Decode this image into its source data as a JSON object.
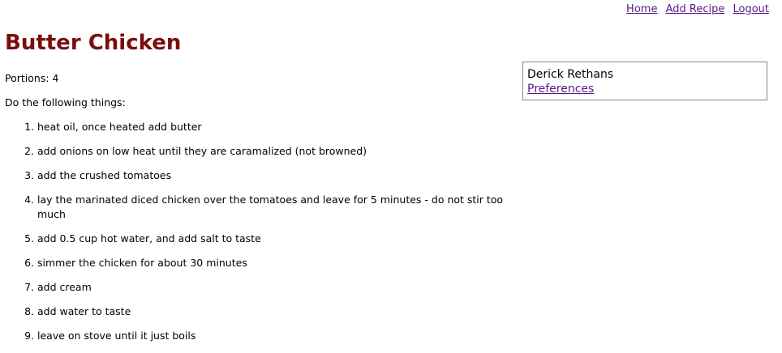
{
  "nav": {
    "home": "Home",
    "add_recipe": "Add Recipe",
    "logout": "Logout"
  },
  "recipe": {
    "title": "Butter Chicken",
    "portions": "Portions: 4",
    "intro": "Do the following things:",
    "steps": [
      "heat oil, once heated add butter",
      "add onions on low heat until they are caramalized (not browned)",
      "add the crushed tomatoes",
      "lay the marinated diced chicken over the tomatoes and leave for 5 minutes - do not stir too much",
      "add 0.5 cup hot water, and add salt to taste",
      "simmer the chicken for about 30 minutes",
      "add cream",
      "add water to taste",
      "leave on stove until it just boils"
    ]
  },
  "user_box": {
    "name": "Derick Rethans",
    "preferences": "Preferences"
  },
  "colors": {
    "title": "#7b0d0d",
    "link": "#551a8b",
    "box_border": "#888888"
  }
}
